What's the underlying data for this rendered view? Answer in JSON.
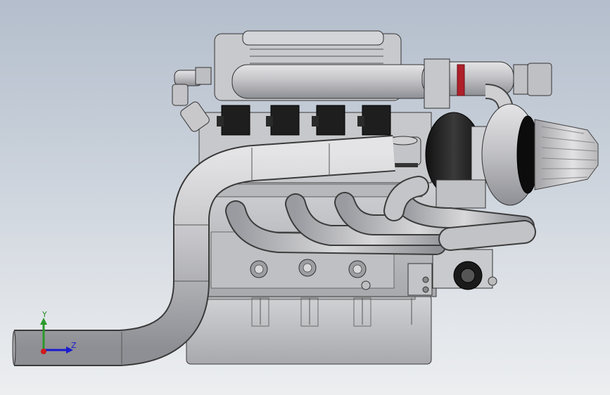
{
  "view": {
    "background_top": "#b4becc",
    "background_bottom": "#eceef0"
  },
  "model": {
    "metal": "#c9c9cc",
    "metal_dark": "#8f9095",
    "coil_color": "#1a1a1a",
    "turbo_housing": "#202020",
    "accent_ring": "#b0202a",
    "filter": "#d6d6d8"
  },
  "triad": {
    "y_label": "Y",
    "z_label": "Z",
    "y_color": "#2a9a2a",
    "z_color": "#1a1ad0",
    "x_color": "#d01a1a"
  }
}
